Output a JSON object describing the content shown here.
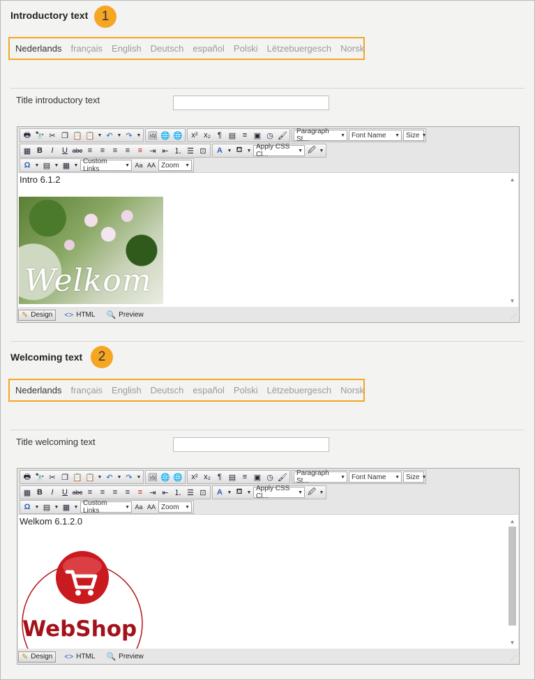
{
  "sections": [
    {
      "title": "Introductory text",
      "badge": "1",
      "languages": [
        "Nederlands",
        "français",
        "English",
        "Deutsch",
        "español",
        "Polski",
        "Lëtzebuergesch",
        "Norsk"
      ],
      "active_language": "Nederlands",
      "field_label": "Title introductory text",
      "field_value": "",
      "editor_text": "Intro 6.1.2",
      "image_text": "Welkom"
    },
    {
      "title": "Welcoming text",
      "badge": "2",
      "languages": [
        "Nederlands",
        "français",
        "English",
        "Deutsch",
        "español",
        "Polski",
        "Lëtzebuergesch",
        "Norsk"
      ],
      "active_language": "Nederlands",
      "field_label": "Title welcoming text",
      "field_value": "",
      "editor_text": "Welkom 6.1.2.0",
      "image_text": "WebShop"
    }
  ],
  "toolbar": {
    "paragraph_style": "Paragraph St...",
    "font_name": "Font Name",
    "size": "Size",
    "apply_css": "Apply CSS Cl...",
    "custom_links": "Custom Links",
    "zoom": "Zoom"
  },
  "modes": {
    "design": "Design",
    "html": "HTML",
    "preview": "Preview"
  },
  "colors": {
    "badge": "#f5a623",
    "langbar_border": "#f5a623",
    "logo_red": "#b3151b"
  }
}
